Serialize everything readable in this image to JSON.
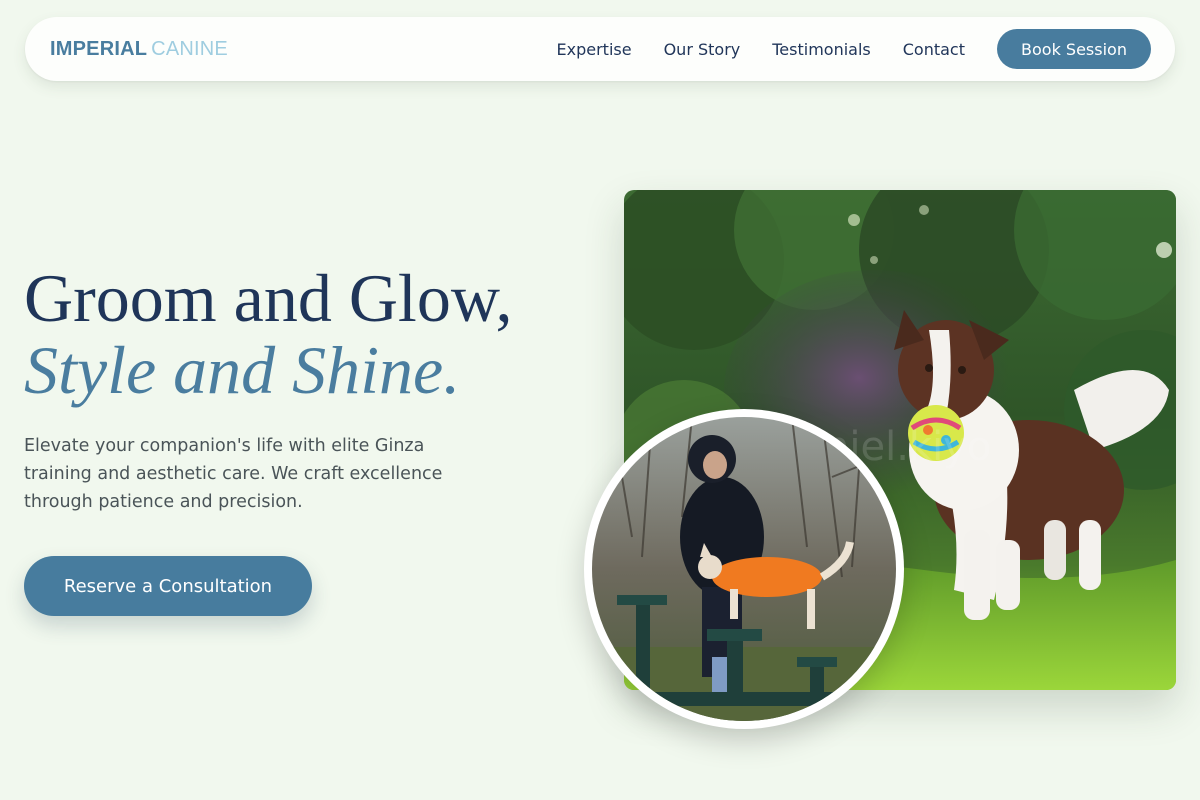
{
  "brand": {
    "name_strong": "IMPERIAL",
    "name_light": "CANINE"
  },
  "nav": {
    "links": [
      "Expertise",
      "Our Story",
      "Testimonials",
      "Contact"
    ],
    "cta": "Book Session"
  },
  "hero": {
    "headline_line1": "Groom and Glow,",
    "headline_line2": "Style and Shine.",
    "description": "Elevate your companion's life with elite Ginza training and aesthetic care. We craft excellence through patience and precision.",
    "cta": "Reserve a Consultation"
  },
  "images": {
    "main": "border-collie-running-with-ball",
    "inset": "trainer-with-dog-on-bench"
  },
  "colors": {
    "background": "#f1f8ee",
    "primary": "#487c9e",
    "navy": "#1f3559",
    "accent_light": "#9fcde0"
  }
}
